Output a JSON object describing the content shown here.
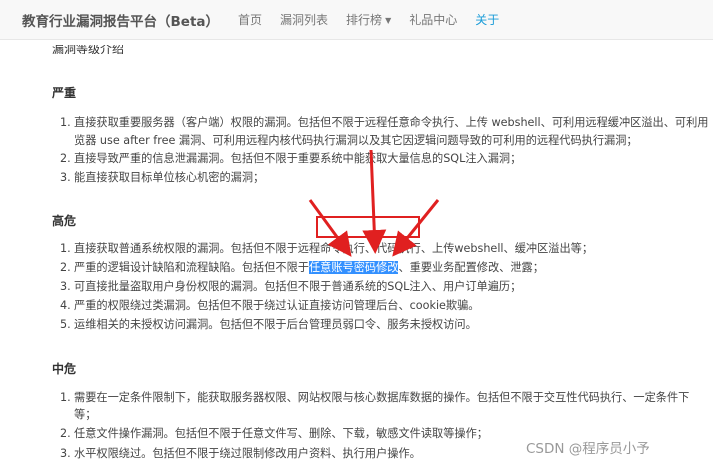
{
  "navbar": {
    "brand": "教育行业漏洞报告平台（Beta）",
    "items": [
      {
        "label": "首页"
      },
      {
        "label": "漏洞列表"
      },
      {
        "label": "排行榜"
      },
      {
        "label": "礼品中心"
      },
      {
        "label": "关于"
      }
    ]
  },
  "cut_line": "漏洞等级介绍",
  "sections": {
    "critical": {
      "title": "严重",
      "items": [
        {
          "num": "1.",
          "line1": "直接获取重要服务器（客户端）权限的漏洞。包括但不限于远程任意命令执行、上传 webshell、可利用远程缓冲区溢出、可利用",
          "line2": "览器 use after free 漏洞、可利用远程内核代码执行漏洞以及其它因逻辑问题导致的可利用的远程代码执行漏洞；"
        },
        {
          "num": "2.",
          "line1": "直接导致严重的信息泄漏漏洞。包括但不限于重要系统中能获取大量信息的SQL注入漏洞；"
        },
        {
          "num": "3.",
          "line1": "能直接获取目标单位核心机密的漏洞；"
        }
      ]
    },
    "high": {
      "title": "高危",
      "items": [
        {
          "num": "1.",
          "line1": "直接获取普通系统权限的漏洞。包括但不限于远程命令执行、代码执行、上传webshell、缓冲区溢出等；"
        },
        {
          "num": "2.",
          "pre": "严重的逻辑设计缺陷和流程缺陷。包括但不限于",
          "highlight": "任意账号密码修改",
          "post": "、重要业务配置修改、泄露；"
        },
        {
          "num": "3.",
          "line1": "可直接批量盗取用户身份权限的漏洞。包括但不限于普通系统的SQL注入、用户订单遍历；"
        },
        {
          "num": "4.",
          "line1": "严重的权限绕过类漏洞。包括但不限于绕过认证直接访问管理后台、cookie欺骗。"
        },
        {
          "num": "5.",
          "line1": "运维相关的未授权访问漏洞。包括但不限于后台管理员弱口令、服务未授权访问。"
        }
      ]
    },
    "medium": {
      "title": "中危",
      "items": [
        {
          "num": "1.",
          "line1": "需要在一定条件限制下，能获取服务器权限、网站权限与核心数据库数据的操作。包括但不限于交互性代码执行、一定条件下",
          "line2": "等；"
        },
        {
          "num": "2.",
          "line1": "任意文件操作漏洞。包括但不限于任意文件写、删除、下载，敏感文件读取等操作；"
        },
        {
          "num": "3.",
          "line1": "水平权限绕过。包括但不限于绕过限制修改用户资料、执行用户操作。"
        }
      ]
    }
  },
  "watermark": "CSDN @程序员小予",
  "colors": {
    "accent": "#1a9cd8",
    "selection": "#3390ff",
    "annotation": "#e02020"
  }
}
